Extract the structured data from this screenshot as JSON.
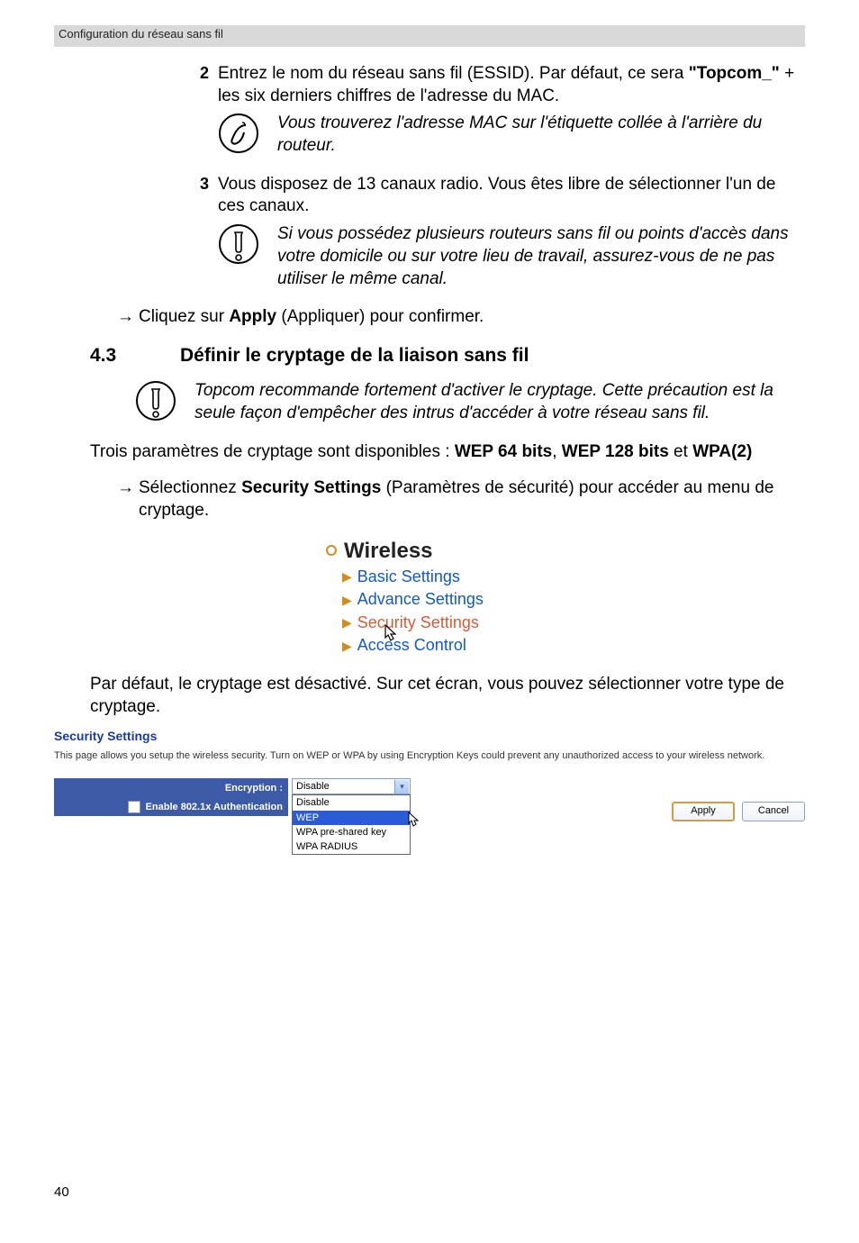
{
  "header": "Configuration du réseau sans fil",
  "steps": {
    "s2": {
      "num": "2",
      "text_a": "Entrez le nom du réseau sans fil (ESSID). Par défaut, ce sera ",
      "text_b": "\"Topcom_\"",
      "text_c": " + les six derniers chiffres de l'adresse du MAC.",
      "note": "Vous trouverez l'adresse MAC sur l'étiquette collée à l'arrière du routeur."
    },
    "s3": {
      "num": "3",
      "text": "Vous disposez de 13 canaux radio. Vous êtes libre de sélectionner l'un de ces canaux.",
      "note": "Si vous possédez plusieurs routeurs sans fil ou points d'accès dans votre domicile ou sur votre lieu de travail, assurez-vous de ne pas utiliser le même canal."
    }
  },
  "apply_line": {
    "pre": "Cliquez sur ",
    "bold": "Apply",
    "post": " (Appliquer) pour confirmer."
  },
  "section": {
    "num": "4.3",
    "title": "Définir le cryptage de la liaison sans fil",
    "note": "Topcom recommande fortement d'activer le cryptage. Cette précaution est la seule façon d'empêcher des intrus d'accéder à votre réseau sans fil."
  },
  "cipher_line": {
    "pre": "Trois paramètres de cryptage sont disponibles : ",
    "b1": "WEP 64 bits",
    "sep1": ", ",
    "b2": "WEP 128 bits",
    "sep2": " et ",
    "b3": "WPA(2)"
  },
  "select_line": {
    "pre": "Sélectionnez ",
    "bold": "Security Settings",
    "post": " (Paramètres de sécurité) pour accéder au menu de cryptage."
  },
  "wireless_menu": {
    "title": "Wireless",
    "items": [
      "Basic Settings",
      "Advance Settings",
      "Security Settings",
      "Access Control"
    ]
  },
  "default_line": "Par défaut, le cryptage est désactivé. Sur cet écran, vous pouvez sélectionner votre type de cryptage.",
  "security_shot": {
    "title": "Security Settings",
    "desc": "This page allows you setup the wireless security. Turn on WEP or WPA by using Encryption Keys could prevent any unauthorized access to your wireless network.",
    "enc_label": "Encryption :",
    "auth_label": "Enable 802.1x Authentication",
    "select_value": "Disable",
    "options": [
      "Disable",
      "WEP",
      "WPA pre-shared key",
      "WPA RADIUS"
    ],
    "apply": "Apply",
    "cancel": "Cancel"
  },
  "page_num": "40"
}
